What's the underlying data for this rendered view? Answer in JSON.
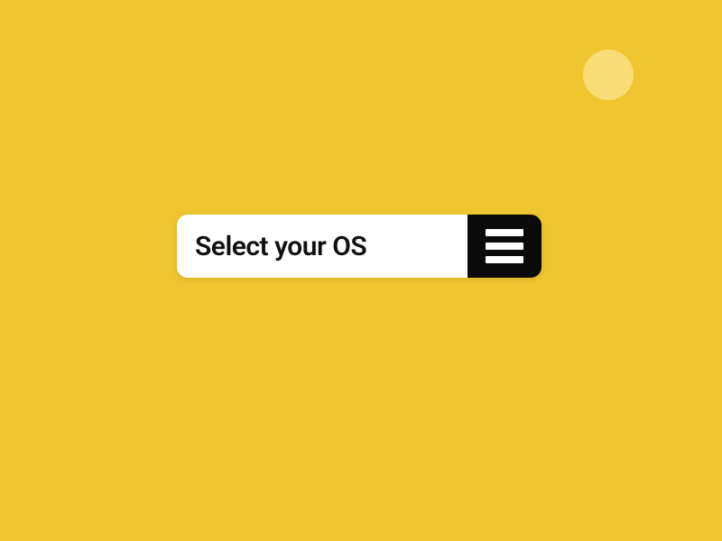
{
  "dropdown": {
    "label": "Select your OS"
  },
  "colors": {
    "background": "#f0c630",
    "dropdown_bg": "#ffffff",
    "button_bg": "#0a0a0a",
    "text": "#111111"
  }
}
